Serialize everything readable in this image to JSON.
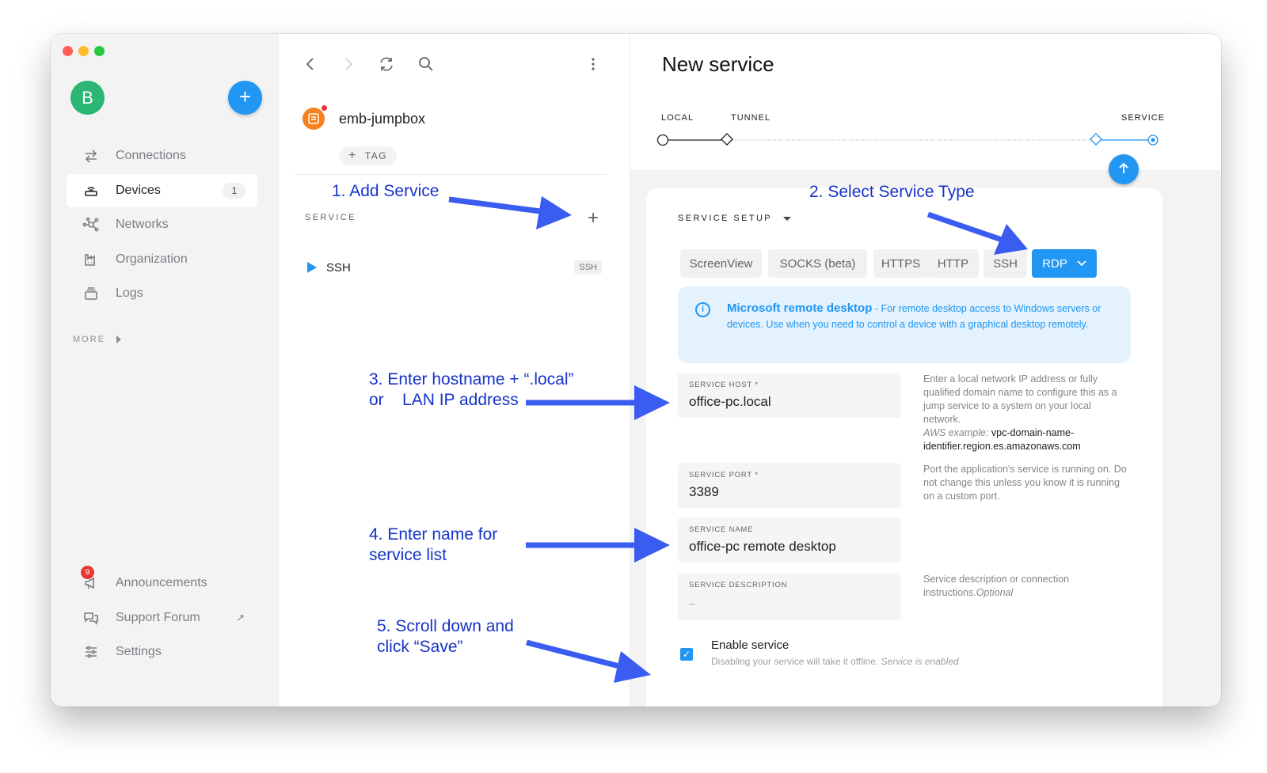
{
  "sidebar": {
    "avatar_initial": "B",
    "add_symbol": "+",
    "nav": [
      {
        "label": "Connections",
        "icon": "swap-arrows-icon"
      },
      {
        "label": "Devices",
        "icon": "router-icon",
        "count": "1"
      },
      {
        "label": "Networks",
        "icon": "network-nodes-icon"
      },
      {
        "label": "Organization",
        "icon": "organization-icon"
      },
      {
        "label": "Logs",
        "icon": "logs-stack-icon"
      }
    ],
    "more_label": "MORE",
    "bottom": [
      {
        "label": "Announcements",
        "icon": "megaphone-icon",
        "badge": "9"
      },
      {
        "label": "Support Forum",
        "icon": "forum-icon",
        "external": "↗"
      },
      {
        "label": "Settings",
        "icon": "sliders-icon"
      }
    ]
  },
  "middle": {
    "device_name": "emb-jumpbox",
    "tag_label": "TAG",
    "tag_plus": "+",
    "service_header": "SERVICE",
    "service_plus": "+",
    "services": [
      {
        "name": "SSH",
        "type": "SSH"
      }
    ]
  },
  "right": {
    "title": "New service",
    "steps": [
      "LOCAL",
      "TUNNEL",
      "SERVICE"
    ],
    "setup_label": "SERVICE SETUP",
    "types": [
      "ScreenView",
      "SOCKS (beta)",
      "HTTPS",
      "HTTP",
      "SSH",
      "RDP"
    ],
    "selected_type": "RDP",
    "info": {
      "icon_char": "i",
      "title": "Microsoft remote desktop",
      "text": " - For remote desktop access to Windows servers or devices. Use when you need to control a device with a graphical desktop remotely."
    },
    "fields": {
      "host": {
        "label": "SERVICE HOST *",
        "value": "office-pc.local",
        "help": "Enter a local network IP address or fully qualified domain name to configure this as a jump service to a system on your local network.",
        "help_example_label": "AWS example:",
        "help_example": " vpc-domain-name-identifier.region.es.amazonaws.com"
      },
      "port": {
        "label": "SERVICE PORT *",
        "value": "3389",
        "help": "Port the application's service is running on. Do not change this unless you know it is running on a custom port."
      },
      "name": {
        "label": "SERVICE NAME",
        "value": "office-pc remote desktop"
      },
      "description": {
        "label": "SERVICE DESCRIPTION",
        "value": "–",
        "help": "Service description or connection instructions.",
        "help_optional": "Optional"
      }
    },
    "enable": {
      "label": "Enable service",
      "desc": "Disabling your service will take it offline.",
      "desc_status": " Service is enabled",
      "checked": true
    }
  },
  "annotations": {
    "step1": "1. Add Service",
    "step2": "2. Select Service Type",
    "step3_line1": "3. Enter hostname + “.local”",
    "step3_line2": "or    LAN IP address",
    "step4_line1": "4. Enter name for",
    "step4_line2": "service list",
    "step5_line1": "5. Scroll down and",
    "step5_line2": "click “Save”"
  },
  "colors": {
    "accent": "#2196f3",
    "annotation": "#1633c8",
    "arrow": "#3a5cf0",
    "badge": "#e53935"
  }
}
